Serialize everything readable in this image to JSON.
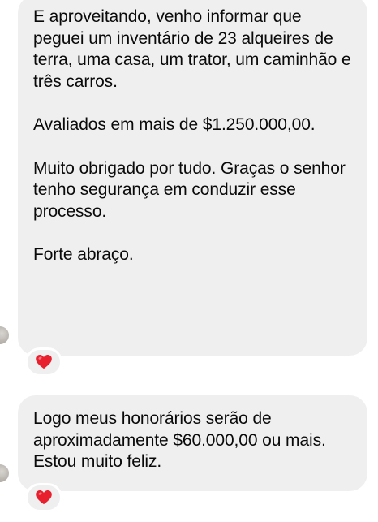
{
  "messages": [
    {
      "paragraphs": [
        "E aproveitando, venho informar que peguei um inventário de 23 alqueires de terra, uma casa, um trator, um caminhão e três carros.",
        "Avaliados em mais de $1.250.000,00.",
        "Muito obrigado por tudo. Graças o senhor tenho segurança em conduzir esse processo.",
        "Forte abraço."
      ],
      "reaction": "heart-emoji"
    },
    {
      "paragraphs": [
        "Logo meus honorários serão de aproximadamente $60.000,00 ou mais. Estou muito feliz."
      ],
      "reaction": "heart-emoji"
    }
  ],
  "colors": {
    "bubble": "#efefef",
    "text": "#0a0a0a",
    "heart": "#e8202e"
  }
}
